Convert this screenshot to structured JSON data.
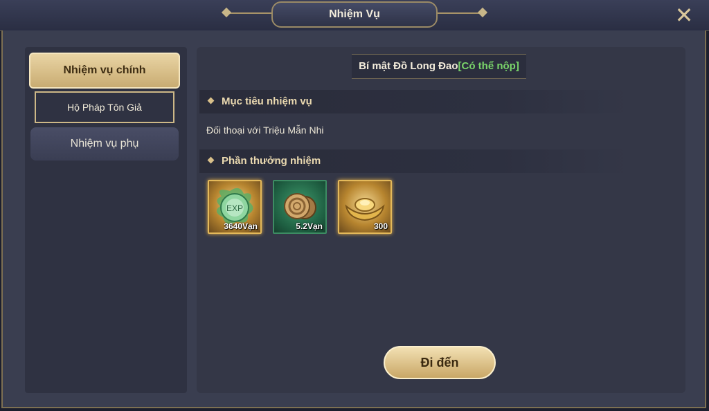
{
  "header": {
    "title": "Nhiệm Vụ"
  },
  "sidebar": {
    "main_tab": "Nhiệm vụ chính",
    "sub_item": "Hộ Pháp Tôn Giả",
    "side_tab": "Nhiệm vụ phụ"
  },
  "quest": {
    "name": "Bí mật Đồ Long Đao",
    "status": "[Có thể nộp]",
    "objective_header": "Mục tiêu nhiệm vụ",
    "objective": "Đối thoại với Triệu Mẫn Nhi",
    "reward_header": "Phần thưởng nhiệm",
    "rewards": [
      {
        "icon": "exp-orb-icon",
        "qty": "3640Vạn"
      },
      {
        "icon": "copper-coin-icon",
        "qty": "5.2Vạn"
      },
      {
        "icon": "gold-ingot-icon",
        "qty": "300"
      }
    ],
    "exp_label": "EXP"
  },
  "actions": {
    "go_label": "Đi đến"
  },
  "colors": {
    "accent_gold": "#d9c08a",
    "status_green": "#7ad56a",
    "panel": "#343747"
  }
}
